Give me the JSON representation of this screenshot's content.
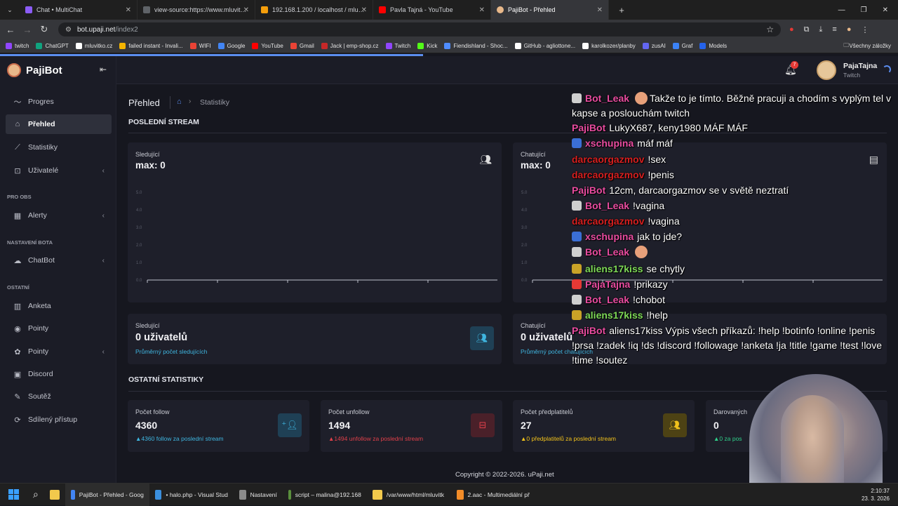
{
  "browser": {
    "tabs": [
      {
        "label": "Chat • MultiChat",
        "color": "#8b5cf6"
      },
      {
        "label": "view-source:https://www.mluvit…",
        "color": "#5f6368"
      },
      {
        "label": "192.168.1.200 / localhost / mlu…",
        "color": "#f59e0b"
      },
      {
        "label": "Pavla Tajná - YouTube",
        "color": "#ff0000"
      },
      {
        "label": "PajiBot - Přehled",
        "color": "#e8b88a",
        "active": true
      }
    ],
    "url_host": "bot.upaji.net",
    "url_path": "/index2",
    "bookmarks": [
      {
        "label": "twitch",
        "color": "#9146ff"
      },
      {
        "label": "ChatGPT",
        "color": "#10a37f"
      },
      {
        "label": "mluvitko.cz",
        "color": "#ffffff"
      },
      {
        "label": "failed instant - Invali...",
        "color": "#f4b400"
      },
      {
        "label": "WIFI",
        "color": "#ea4335"
      },
      {
        "label": "Google",
        "color": "#4285f4"
      },
      {
        "label": "YouTube",
        "color": "#ff0000"
      },
      {
        "label": "Gmail",
        "color": "#ea4335"
      },
      {
        "label": "Jack | emp-shop.cz",
        "color": "#c62828"
      },
      {
        "label": "Twitch",
        "color": "#9146ff"
      },
      {
        "label": "Kick",
        "color": "#53fc18"
      },
      {
        "label": "Fiendishland - Shoc...",
        "color": "#4f8cff"
      },
      {
        "label": "GitHub - agliottone...",
        "color": "#ffffff"
      },
      {
        "label": "karolkozer/planby",
        "color": "#ffffff"
      },
      {
        "label": "zusAI",
        "color": "#6366f1"
      },
      {
        "label": "Graf",
        "color": "#3b82f6"
      },
      {
        "label": "Models",
        "color": "#2563eb"
      }
    ],
    "all_bookmarks": "Všechny záložky"
  },
  "app": {
    "brand": "PajiBot",
    "user_name": "PajaTajna",
    "user_platform": "Twitch",
    "notif_count": "7",
    "sidebar": {
      "items": [
        {
          "label": "Progres",
          "icon": "chart-line-icon"
        },
        {
          "label": "Přehled",
          "icon": "home-icon",
          "active": true
        },
        {
          "label": "Statistiky",
          "icon": "chart-icon"
        },
        {
          "label": "Uživatelé",
          "icon": "user-icon",
          "chevron": true
        }
      ],
      "sec_obs": "PRO OBS",
      "obs_items": [
        {
          "label": "Alerty",
          "icon": "alert-icon",
          "chevron": true
        }
      ],
      "sec_bot": "NASTAVENÍ BOTA",
      "bot_items": [
        {
          "label": "ChatBot",
          "icon": "chat-icon",
          "chevron": true
        }
      ],
      "sec_other": "OSTATNÍ",
      "other_items": [
        {
          "label": "Anketa",
          "icon": "poll-icon"
        },
        {
          "label": "Pointy",
          "icon": "points-icon"
        },
        {
          "label": "Pointy",
          "icon": "points-icon",
          "chevron": true
        },
        {
          "label": "Discord",
          "icon": "discord-icon"
        },
        {
          "label": "Soutěž",
          "icon": "contest-icon"
        },
        {
          "label": "Sdílený přístup",
          "icon": "share-icon"
        }
      ]
    },
    "breadcrumb": {
      "title": "Přehled",
      "current": "Statistiky"
    },
    "last_stream_heading": "POSLEDNÍ STREAM",
    "chart1": {
      "label": "Sledující",
      "max": "max: 0"
    },
    "chart2": {
      "label": "Chatující",
      "max": "max: 0"
    },
    "chart_ticks": [
      "0.0",
      "1.0",
      "2.0",
      "3.0",
      "4.0",
      "5.0"
    ],
    "stat_followers": {
      "label": "Sledující",
      "value": "0 uživatelů",
      "sub": "Průměrný počet sledujících"
    },
    "stat_chatters": {
      "label": "Chatující",
      "value": "0 uživatelů",
      "sub": "Průměrný počet chatujících"
    },
    "other_heading": "OSTATNÍ STATISTIKY",
    "other": [
      {
        "label": "Počet follow",
        "value": "4360",
        "sub": "4360 follow za poslední stream",
        "color": "#3fb6e0"
      },
      {
        "label": "Počet unfollow",
        "value": "1494",
        "sub": "1494 unfollow za poslední stream",
        "color": "#e0404a"
      },
      {
        "label": "Počet předplatitelů",
        "value": "27",
        "sub": "0 předplatitelů za poslední stream",
        "color": "#f2c21b"
      },
      {
        "label": "Darovaných",
        "value": "0",
        "sub": "0 za pos",
        "color": "#2fd08a"
      }
    ],
    "footer": "Copyright © 2022-2026. uPaji.net"
  },
  "chat": [
    {
      "user": "Bot_Leak",
      "color": "#e94ca0",
      "text": "Takže to je tímto. Běžně pracuji a chodím s vyplým tel v kapse a poslouchám twitch"
    },
    {
      "user": "PajiBot",
      "color": "#e94ca0",
      "text": "LukyX687, keny1980 MÁF MÁF"
    },
    {
      "user": "xschupina",
      "color": "#e94ca0",
      "text": "máf máf"
    },
    {
      "user": "darcaorgazmov",
      "color": "#d61f1f",
      "text": "!sex"
    },
    {
      "user": "darcaorgazmov",
      "color": "#d61f1f",
      "text": "!penis"
    },
    {
      "user": "PajiBot",
      "color": "#e94ca0",
      "text": "12cm, darcaorgazmov se v světě neztratí"
    },
    {
      "user": "Bot_Leak",
      "color": "#e94ca0",
      "text": "!vagina"
    },
    {
      "user": "darcaorgazmov",
      "color": "#d61f1f",
      "text": "!vagina"
    },
    {
      "user": "xschupina",
      "color": "#e94ca0",
      "text": "jak to jde?"
    },
    {
      "user": "Bot_Leak",
      "color": "#e94ca0",
      "text": ""
    },
    {
      "user": "aliens17kiss",
      "color": "#7ed957",
      "text": "se chytly"
    },
    {
      "user": "PajaTajna",
      "color": "#e94ca0",
      "text": "!prikazy"
    },
    {
      "user": "Bot_Leak",
      "color": "#e94ca0",
      "text": "!chobot"
    },
    {
      "user": "aliens17kiss",
      "color": "#7ed957",
      "text": "!help"
    },
    {
      "user": "PajiBot",
      "color": "#e94ca0",
      "text": "aliens17kiss Výpis všech příkazů: !help !botinfo !online !penis !prsa !zadek !iq !ds !discord !followage !anketa !ja !title !game !test !love !time !soutez"
    }
  ],
  "taskbar": [
    {
      "label": "PajiBot - Přehled - Goog",
      "color": "#4285f4"
    },
    {
      "label": "• halo.php - Visual Stud",
      "color": "#3b8fdd"
    },
    {
      "label": "Nastavení",
      "color": "#8a8a8a"
    },
    {
      "label": "script – malina@192.168",
      "color": "#5a8f3c"
    },
    {
      "label": "/var/www/html/mluvitk",
      "color": "#f2c94c"
    },
    {
      "label": "2.aac - Multimediální př",
      "color": "#f28c28"
    }
  ],
  "clock": {
    "time": "2:10:37",
    "date": "23. 3. 2026"
  }
}
